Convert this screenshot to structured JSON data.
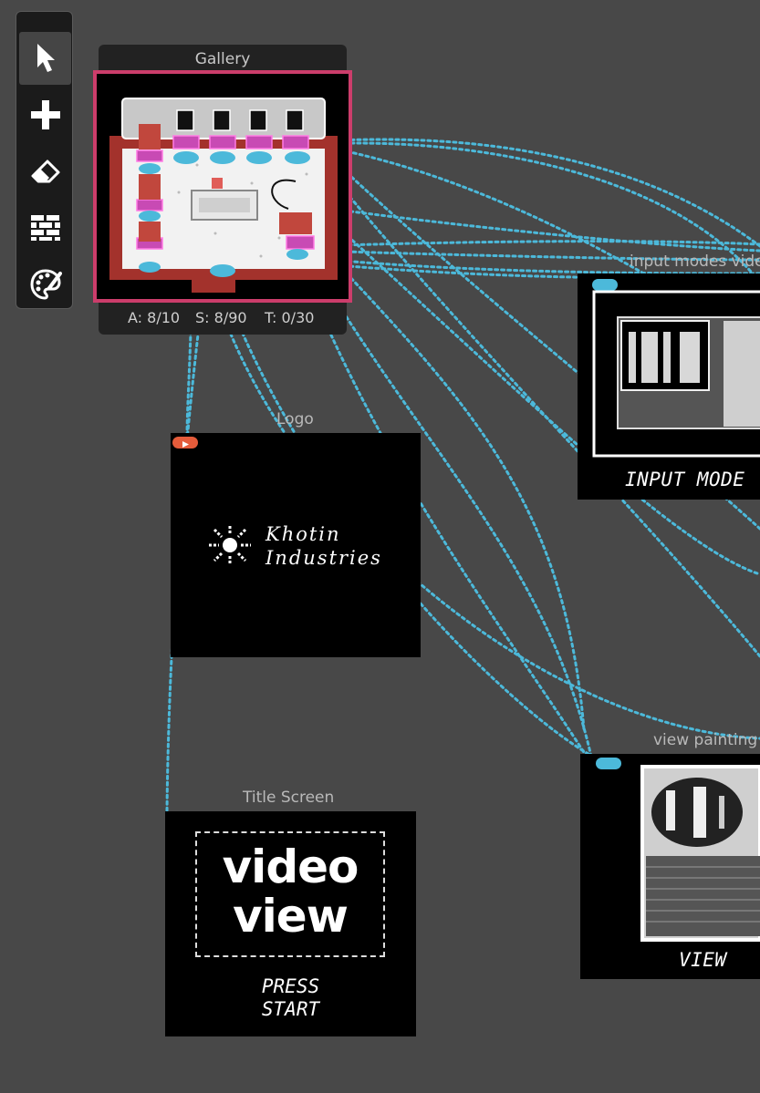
{
  "toolbar": {
    "tools": [
      {
        "icon": "select-arrow-icon",
        "active": true
      },
      {
        "icon": "add-plus-icon",
        "active": false
      },
      {
        "icon": "eraser-icon",
        "active": false
      },
      {
        "icon": "wall-bricks-icon",
        "active": false
      },
      {
        "icon": "palette-icon",
        "active": false
      }
    ]
  },
  "rooms": {
    "gallery": {
      "title": "Gallery",
      "stats": {
        "a": "A: 8/10",
        "s": "S: 8/90",
        "t": "T: 0/30"
      }
    },
    "input_modes": {
      "title": "input modes vide",
      "caption": "INPUT MODE"
    },
    "logo": {
      "title": "Logo",
      "logo_line1": "Khotin",
      "logo_line2": "Industries"
    },
    "view_painting": {
      "title": "view painting",
      "caption": "VIEW"
    },
    "title_screen": {
      "title": "Title Screen",
      "logo_line1": "video",
      "logo_line2": "view",
      "caption_line1": "PRESS",
      "caption_line2": "START"
    }
  },
  "colors": {
    "canvas": "#484848",
    "wire": "#4cb9da",
    "selection": "#cc3d6b",
    "start_badge": "#e55c3b"
  }
}
